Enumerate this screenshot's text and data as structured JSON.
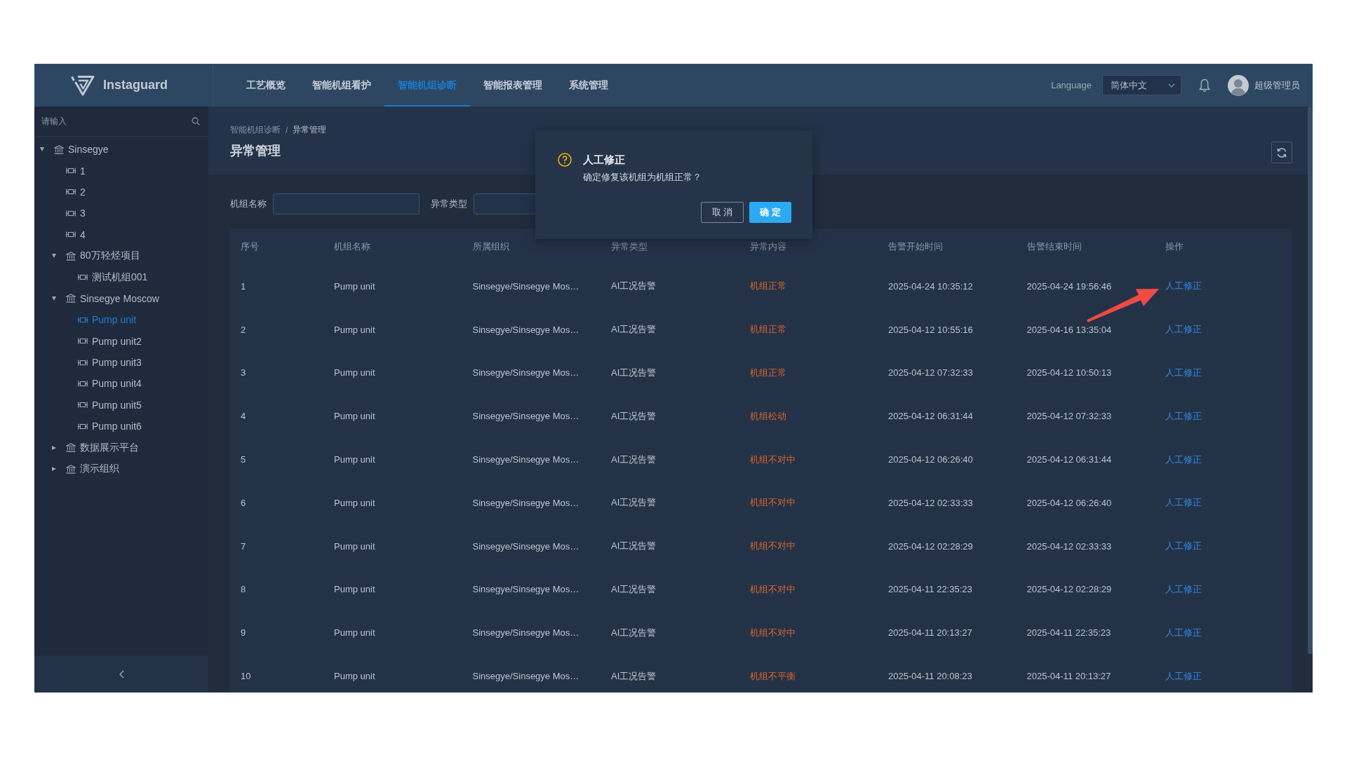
{
  "header": {
    "brand": "Instaguard",
    "nav": [
      {
        "label": "工艺概览",
        "selected": false
      },
      {
        "label": "智能机组看护",
        "selected": false
      },
      {
        "label": "智能机组诊断",
        "selected": true
      },
      {
        "label": "智能报表管理",
        "selected": false
      },
      {
        "label": "系统管理",
        "selected": false
      }
    ],
    "language_label": "Language",
    "language_select": {
      "value": "简体中文"
    },
    "user": {
      "name": "超级管理员"
    }
  },
  "sidebar": {
    "search": {
      "placeholder": "请输入"
    },
    "tree": [
      {
        "label": "Sinsegye",
        "kind": "org",
        "expanded": true,
        "selected": false,
        "children": [
          {
            "label": "1",
            "kind": "unit",
            "selected": false
          },
          {
            "label": "2",
            "kind": "unit",
            "selected": false
          },
          {
            "label": "3",
            "kind": "unit",
            "selected": false
          },
          {
            "label": "4",
            "kind": "unit",
            "selected": false
          },
          {
            "label": "80万轻烃项目",
            "kind": "org",
            "expanded": true,
            "selected": false,
            "children": [
              {
                "label": "测试机组001",
                "kind": "unit",
                "selected": false
              }
            ]
          },
          {
            "label": "Sinsegye Moscow",
            "kind": "org",
            "expanded": true,
            "selected": false,
            "children": [
              {
                "label": "Pump unit",
                "kind": "unit",
                "selected": true
              },
              {
                "label": "Pump unit2",
                "kind": "unit",
                "selected": false
              },
              {
                "label": "Pump unit3",
                "kind": "unit",
                "selected": false
              },
              {
                "label": "Pump unit4",
                "kind": "unit",
                "selected": false
              },
              {
                "label": "Pump unit5",
                "kind": "unit",
                "selected": false
              },
              {
                "label": "Pump unit6",
                "kind": "unit",
                "selected": false
              }
            ]
          },
          {
            "label": "数据展示平台",
            "kind": "org",
            "expanded": false,
            "selected": false
          },
          {
            "label": "演示组织",
            "kind": "org",
            "expanded": false,
            "selected": false
          }
        ]
      }
    ]
  },
  "page": {
    "breadcrumb": [
      {
        "label": "智能机组诊断"
      },
      {
        "label": "异常管理"
      }
    ],
    "breadcrumb_separator": "/",
    "title": "异常管理"
  },
  "filters": [
    {
      "label": "机组名称"
    },
    {
      "label": "异常类型"
    }
  ],
  "table": {
    "columns": [
      "序号",
      "机组名称",
      "所属组织",
      "异常类型",
      "异常内容",
      "告警开始时间",
      "告警结束时间",
      "操作"
    ],
    "rows": [
      {
        "no": "1",
        "unit_name": "Pump unit",
        "organization": "Sinsegye/Sinsegye Mos…",
        "anomaly_type": "AI工况告警",
        "anomaly_content": "机组正常",
        "alarm_start": "2025-04-24 10:35:12",
        "alarm_end": "2025-04-24 19:56:46",
        "action": "人工修正"
      },
      {
        "no": "2",
        "unit_name": "Pump unit",
        "organization": "Sinsegye/Sinsegye Mos…",
        "anomaly_type": "AI工况告警",
        "anomaly_content": "机组正常",
        "alarm_start": "2025-04-12 10:55:16",
        "alarm_end": "2025-04-16 13:35:04",
        "action": "人工修正"
      },
      {
        "no": "3",
        "unit_name": "Pump unit",
        "organization": "Sinsegye/Sinsegye Mos…",
        "anomaly_type": "AI工况告警",
        "anomaly_content": "机组正常",
        "alarm_start": "2025-04-12 07:32:33",
        "alarm_end": "2025-04-12 10:50:13",
        "action": "人工修正"
      },
      {
        "no": "4",
        "unit_name": "Pump unit",
        "organization": "Sinsegye/Sinsegye Mos…",
        "anomaly_type": "AI工况告警",
        "anomaly_content": "机组松动",
        "alarm_start": "2025-04-12 06:31:44",
        "alarm_end": "2025-04-12 07:32:33",
        "action": "人工修正"
      },
      {
        "no": "5",
        "unit_name": "Pump unit",
        "organization": "Sinsegye/Sinsegye Mos…",
        "anomaly_type": "AI工况告警",
        "anomaly_content": "机组不对中",
        "alarm_start": "2025-04-12 06:26:40",
        "alarm_end": "2025-04-12 06:31:44",
        "action": "人工修正"
      },
      {
        "no": "6",
        "unit_name": "Pump unit",
        "organization": "Sinsegye/Sinsegye Mos…",
        "anomaly_type": "AI工况告警",
        "anomaly_content": "机组不对中",
        "alarm_start": "2025-04-12 02:33:33",
        "alarm_end": "2025-04-12 06:26:40",
        "action": "人工修正"
      },
      {
        "no": "7",
        "unit_name": "Pump unit",
        "organization": "Sinsegye/Sinsegye Mos…",
        "anomaly_type": "AI工况告警",
        "anomaly_content": "机组不对中",
        "alarm_start": "2025-04-12 02:28:29",
        "alarm_end": "2025-04-12 02:33:33",
        "action": "人工修正"
      },
      {
        "no": "8",
        "unit_name": "Pump unit",
        "organization": "Sinsegye/Sinsegye Mos…",
        "anomaly_type": "AI工况告警",
        "anomaly_content": "机组不对中",
        "alarm_start": "2025-04-11 22:35:23",
        "alarm_end": "2025-04-12 02:28:29",
        "action": "人工修正"
      },
      {
        "no": "9",
        "unit_name": "Pump unit",
        "organization": "Sinsegye/Sinsegye Mos…",
        "anomaly_type": "AI工况告警",
        "anomaly_content": "机组不对中",
        "alarm_start": "2025-04-11 20:13:27",
        "alarm_end": "2025-04-11 22:35:23",
        "action": "人工修正"
      },
      {
        "no": "10",
        "unit_name": "Pump unit",
        "organization": "Sinsegye/Sinsegye Mos…",
        "anomaly_type": "AI工况告警",
        "anomaly_content": "机组不平衡",
        "alarm_start": "2025-04-11 20:08:23",
        "alarm_end": "2025-04-11 20:13:27",
        "action": "人工修正"
      }
    ]
  },
  "dialog": {
    "title": "人工修正",
    "message": "确定修复该机组为机组正常？",
    "buttons": [
      {
        "label": "取 消",
        "kind": "default"
      },
      {
        "label": "确 定",
        "kind": "primary"
      }
    ]
  }
}
